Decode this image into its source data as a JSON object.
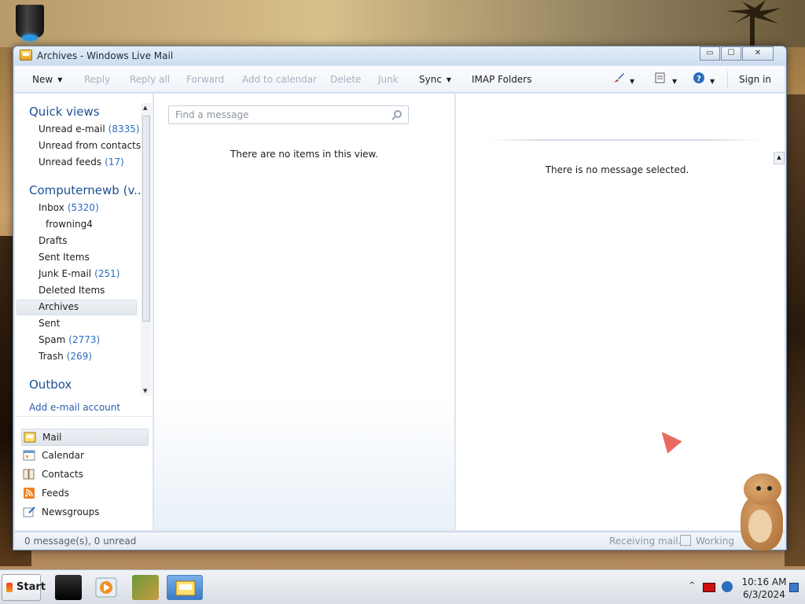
{
  "window": {
    "title": "Archives - Windows Live Mail",
    "buttons": {
      "minimize": "▭",
      "maximize": "☐",
      "close": "✕"
    }
  },
  "toolbar": {
    "new": "New",
    "reply": "Reply",
    "reply_all": "Reply all",
    "forward": "Forward",
    "add_to_calendar": "Add to calendar",
    "delete": "Delete",
    "junk": "Junk",
    "sync": "Sync",
    "imap_folders": "IMAP Folders",
    "sign_in": "Sign in",
    "icons": [
      "paintbrush-icon",
      "view-icon",
      "help-icon"
    ]
  },
  "nav": {
    "quick_views": {
      "title": "Quick views",
      "items": [
        {
          "label": "Unread e-mail",
          "count": "(8335)"
        },
        {
          "label": "Unread from contacts",
          "count": ""
        },
        {
          "label": "Unread feeds",
          "count": "(17)"
        }
      ]
    },
    "account": {
      "title": "Computernewb (v...",
      "items": [
        {
          "label": "Inbox",
          "count": "(5320)"
        },
        {
          "label": "frowning4",
          "count": ""
        },
        {
          "label": "Drafts",
          "count": ""
        },
        {
          "label": "Sent Items",
          "count": ""
        },
        {
          "label": "Junk E-mail",
          "count": "(251)"
        },
        {
          "label": "Deleted Items",
          "count": ""
        },
        {
          "label": "Archives",
          "count": ""
        },
        {
          "label": "Sent",
          "count": ""
        },
        {
          "label": "Spam",
          "count": "(2773)"
        },
        {
          "label": "Trash",
          "count": "(269)"
        }
      ]
    },
    "outbox": "Outbox",
    "add_account": "Add e-mail account",
    "modules": [
      "Mail",
      "Calendar",
      "Contacts",
      "Feeds",
      "Newsgroups"
    ]
  },
  "list": {
    "search_placeholder": "Find a message",
    "empty_text": "There are no items in this view."
  },
  "reading": {
    "empty_text": "There is no message selected."
  },
  "status": {
    "left": "0 message(s), 0 unread",
    "receiving": "Receiving mail...",
    "working": "Working"
  },
  "taskbar": {
    "start": "Start",
    "time": "10:16 AM",
    "date": "6/3/2024"
  },
  "colors": {
    "accent_blue": "#1d4f91",
    "count_blue": "#2a6ebb",
    "disabled_text": "#a9b2bd"
  }
}
